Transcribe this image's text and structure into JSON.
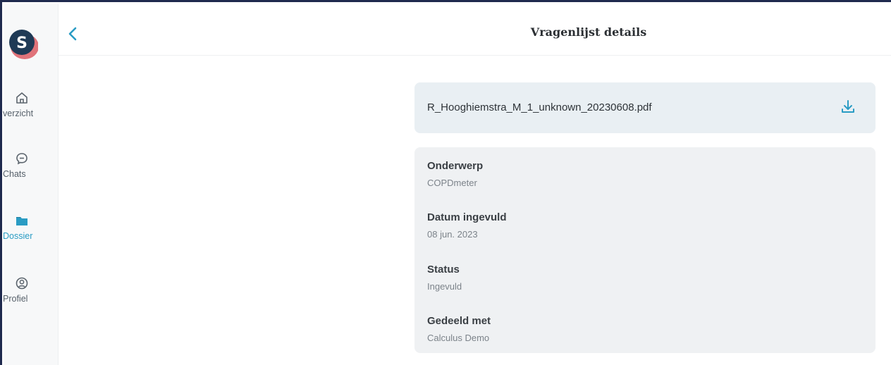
{
  "app": {
    "logo_letter": "S",
    "brand_color": "#2a9cc4",
    "logo_bg": "#1f3a56",
    "logo_accent": "#e0737a"
  },
  "sidebar": {
    "items": [
      {
        "label": "verzicht",
        "icon": "home-icon",
        "active": false
      },
      {
        "label": "Chats",
        "icon": "chat-bubble-icon",
        "active": false
      },
      {
        "label": "Dossier",
        "icon": "folder-icon",
        "active": true
      },
      {
        "label": "Profiel",
        "icon": "profile-icon",
        "active": false
      }
    ]
  },
  "header": {
    "back_icon": "chevron-left-icon",
    "title": "Vragenlijst details"
  },
  "file": {
    "name": "R_Hooghiemstra_M_1_unknown_20230608.pdf",
    "download_icon": "download-icon"
  },
  "details": [
    {
      "label": "Onderwerp",
      "value": "COPDmeter"
    },
    {
      "label": "Datum ingevuld",
      "value": "08 jun. 2023"
    },
    {
      "label": "Status",
      "value": "Ingevuld"
    },
    {
      "label": "Gedeeld met",
      "value": "Calculus Demo"
    }
  ]
}
